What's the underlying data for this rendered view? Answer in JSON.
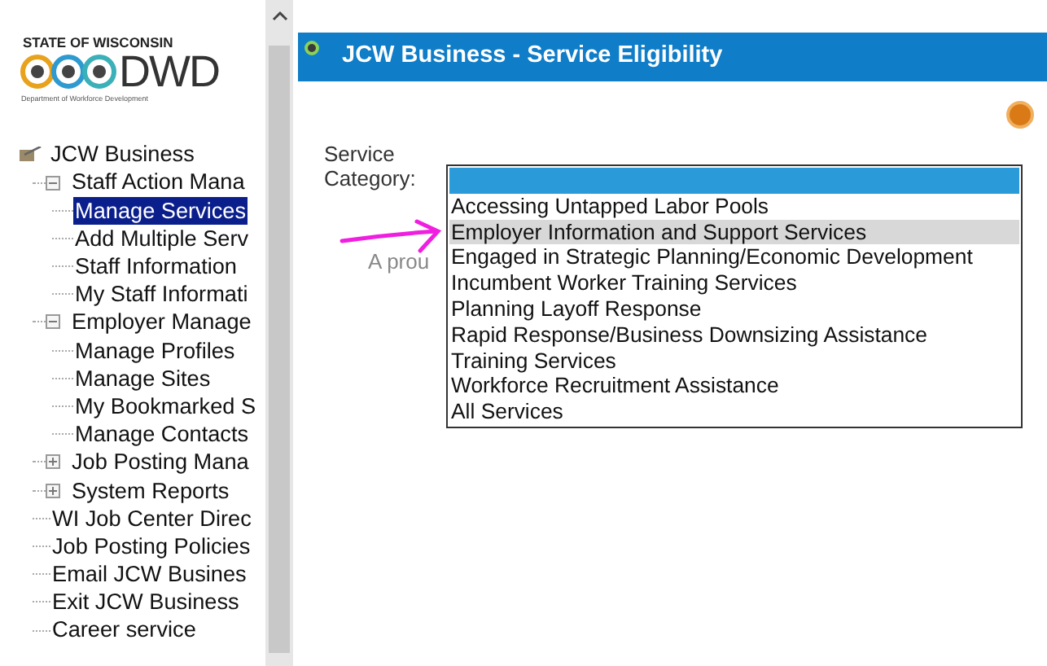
{
  "logo": {
    "state": "STATE OF WISCONSIN",
    "mark": "DWD",
    "department": "Department of Workforce Development"
  },
  "tree": {
    "label": "JCW Business",
    "children": [
      {
        "label": "Staff Action Mana",
        "expanded": true,
        "selected": false,
        "children": [
          {
            "label": "Manage Services",
            "selected": true
          },
          {
            "label": "Add Multiple Serv",
            "selected": false
          },
          {
            "label": "Staff Information",
            "selected": false
          },
          {
            "label": "My Staff Informati",
            "selected": false
          }
        ]
      },
      {
        "label": "Employer Manage",
        "expanded": true,
        "selected": false,
        "children": [
          {
            "label": "Manage Profiles",
            "selected": false
          },
          {
            "label": "Manage Sites",
            "selected": false
          },
          {
            "label": "My Bookmarked S",
            "selected": false
          },
          {
            "label": "Manage Contacts",
            "selected": false
          }
        ]
      },
      {
        "label": "Job Posting Mana",
        "expanded": false,
        "selected": false
      },
      {
        "label": "System Reports",
        "expanded": false,
        "selected": false
      },
      {
        "label": "WI Job Center Direc",
        "selected": false
      },
      {
        "label": "Job Posting Policies",
        "selected": false
      },
      {
        "label": "Email JCW Busines",
        "selected": false
      },
      {
        "label": "Exit JCW Business",
        "selected": false
      },
      {
        "label": "Career service",
        "selected": false
      }
    ]
  },
  "header": {
    "title": "JCW Business - Service Eligibility"
  },
  "form": {
    "label": "Service Category:",
    "background_text": "A prou",
    "options": [
      {
        "selected": true,
        "hovered": false
      },
      {
        "label": "Accessing Untapped Labor Pools",
        "selected": false,
        "hovered": false
      },
      {
        "label": "Employer Information and Support Services",
        "selected": false,
        "hovered": true
      },
      {
        "label": "Engaged in Strategic Planning/Economic Development",
        "selected": false,
        "hovered": false
      },
      {
        "label": "Incumbent Worker Training Services",
        "selected": false,
        "hovered": false
      },
      {
        "label": "Planning Layoff Response",
        "selected": false,
        "hovered": false
      },
      {
        "label": "Rapid Response/Business Downsizing Assistance",
        "selected": false,
        "hovered": false
      },
      {
        "label": "Training Services",
        "selected": false,
        "hovered": false
      },
      {
        "label": "Workforce Recruitment Assistance",
        "selected": false,
        "hovered": false
      },
      {
        "label": "All Services",
        "selected": false,
        "hovered": false
      }
    ]
  }
}
